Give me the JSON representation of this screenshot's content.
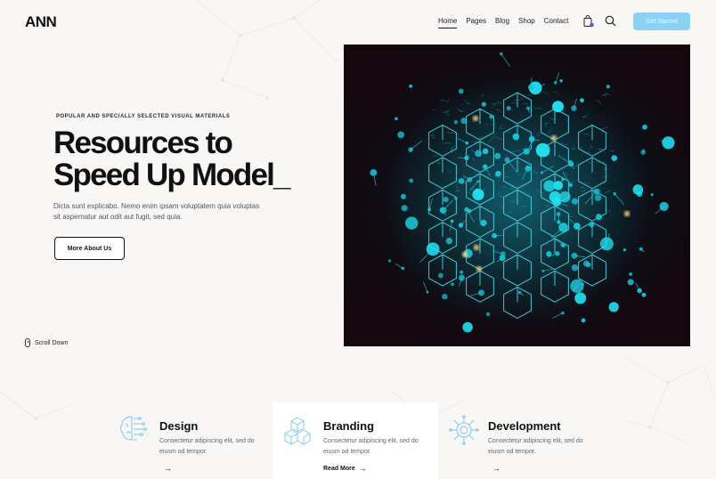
{
  "header": {
    "logo": "ANN",
    "nav": [
      "Home",
      "Pages",
      "Blog",
      "Shop",
      "Contact"
    ],
    "active_nav": "Home",
    "cart_badge": "0",
    "cta_label": "Get Started"
  },
  "hero": {
    "eyebrow": "POPULAR AND SPECIALLY SELECTED  VISUAL MATERIALS",
    "headline_line1": "Resources to",
    "headline_line2": "Speed Up Model_",
    "description": "Dicta sunt explicabo. Nemo enim ipsam voluptatem quia voluptas sit aspernatur aut odit aut fugit, sed quia.",
    "button_label": "More About Us",
    "scroll_label": "Scroll Down",
    "image_icon": "neural-network-brain-illustration"
  },
  "services": [
    {
      "title": "Design",
      "text": "Consectetur adipiscing elit, sed do eiusm od tempor.",
      "link": "",
      "icon": "brain-circuit-icon"
    },
    {
      "title": "Branding",
      "text": "Consectetur adipiscing elit, sed do eiusm od tempor.",
      "link": "Read More",
      "icon": "cubes-icon"
    },
    {
      "title": "Development",
      "text": "Consectetur adipiscing elit, sed do eiusm od tempor.",
      "link": "",
      "icon": "chip-icon"
    }
  ],
  "colors": {
    "accent": "#8ad2f3",
    "background": "#f8f7f5",
    "text": "#16161d",
    "glow": "#22e3f5"
  }
}
